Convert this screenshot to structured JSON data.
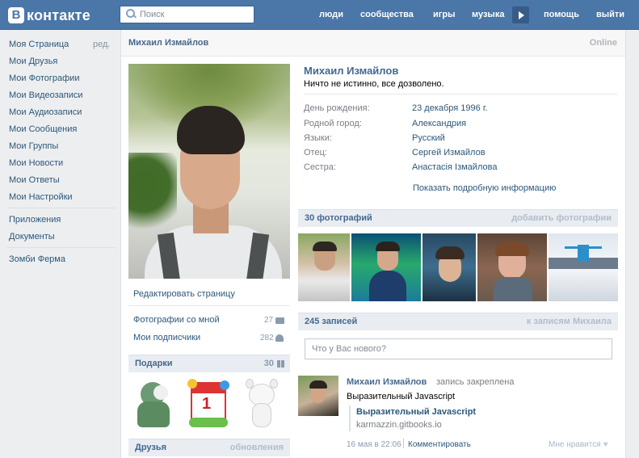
{
  "header": {
    "logo_letter": "В",
    "logo_text": "контакте",
    "search_placeholder": "Поиск",
    "nav": [
      "люди",
      "сообщества",
      "игры",
      "музыка",
      "помощь",
      "выйти"
    ]
  },
  "left_menu": {
    "edit_label": "ред.",
    "items": [
      "Моя Страница",
      "Мои Друзья",
      "Мои Фотографии",
      "Мои Видеозаписи",
      "Мои Аудиозаписи",
      "Мои Сообщения",
      "Мои Группы",
      "Мои Новости",
      "Мои Ответы",
      "Мои Настройки"
    ],
    "extra": [
      "Приложения",
      "Документы"
    ],
    "apps": [
      "Зомби Ферма"
    ]
  },
  "page": {
    "header_name": "Михаил Измайлов",
    "online": "Online"
  },
  "profile_left": {
    "edit_page": "Редактировать страницу",
    "photos_with_me": "Фотографии со мной",
    "photos_with_me_count": "27",
    "subscribers": "Мои подписчики",
    "subscribers_count": "282",
    "gifts_title": "Подарки",
    "gifts_count": "30",
    "friends_title": "Друзья",
    "friends_updates": "обновления"
  },
  "profile": {
    "name": "Михаил Измайлов",
    "status": "Ничто не истинно, все дозволено.",
    "fields": [
      {
        "label": "День рождения:",
        "value": "23 декабря 1996 г."
      },
      {
        "label": "Родной город:",
        "value": "Александрия"
      },
      {
        "label": "Языки:",
        "value": "Русский"
      },
      {
        "label": "Отец:",
        "value": "Сергей Измайлов"
      },
      {
        "label": "Сестра:",
        "value": "Анастасія Ізмайлова"
      }
    ],
    "show_more": "Показать подробную информацию"
  },
  "photos": {
    "title": "30 фотографий",
    "add": "добавить фотографии"
  },
  "wall": {
    "title": "245 записей",
    "to_posts": "к записям Михаила",
    "input_placeholder": "Что у Вас нового?",
    "post": {
      "author": "Михаил Измайлов",
      "pinned": "запись закреплена",
      "text": "Выразительный Javascript",
      "link_title": "Выразительный Javascript",
      "link_url": "karmazzin.gitbooks.io",
      "date": "16 мая в 22:06",
      "comment": "Комментировать",
      "like": "Мне нравится"
    }
  },
  "colors": {
    "header_bg": "#4a76a8",
    "link": "#2b587a",
    "name": "#45688e"
  }
}
